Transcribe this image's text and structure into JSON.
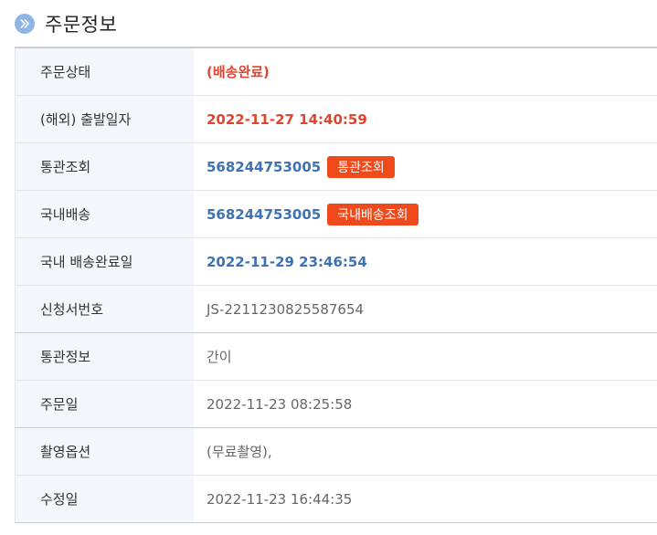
{
  "section": {
    "title": "주문정보",
    "icon": "chevron-right-circle-icon",
    "icon_color": "#8fb4e6"
  },
  "rows": [
    {
      "label": "주문상태",
      "value": "(배송완료)",
      "style": "red"
    },
    {
      "label": "(해외) 출발일자",
      "value": "2022-11-27 14:40:59",
      "style": "red"
    },
    {
      "label": "통관조회",
      "value": "568244753005",
      "style": "blue",
      "button": "통관조회"
    },
    {
      "label": "국내배송",
      "value": "568244753005",
      "style": "blue",
      "button": "국내배송조회"
    },
    {
      "label": "국내 배송완료일",
      "value": "2022-11-29 23:46:54",
      "style": "blue"
    },
    {
      "label": "신청서번호",
      "value": "JS-2211230825587654",
      "style": "gray"
    },
    {
      "label": "통관정보",
      "value": "간이",
      "style": "gray"
    },
    {
      "label": "주문일",
      "value": "2022-11-23 08:25:58",
      "style": "gray"
    },
    {
      "label": "촬영옵션",
      "value": "(무료촬영),",
      "style": "gray"
    },
    {
      "label": "수정일",
      "value": "2022-11-23 16:44:35",
      "style": "gray"
    }
  ],
  "colors": {
    "accent_red": "#e2452e",
    "accent_blue": "#3d72b4",
    "button_bg": "#f04a1c",
    "label_bg": "#f3f6fa"
  }
}
